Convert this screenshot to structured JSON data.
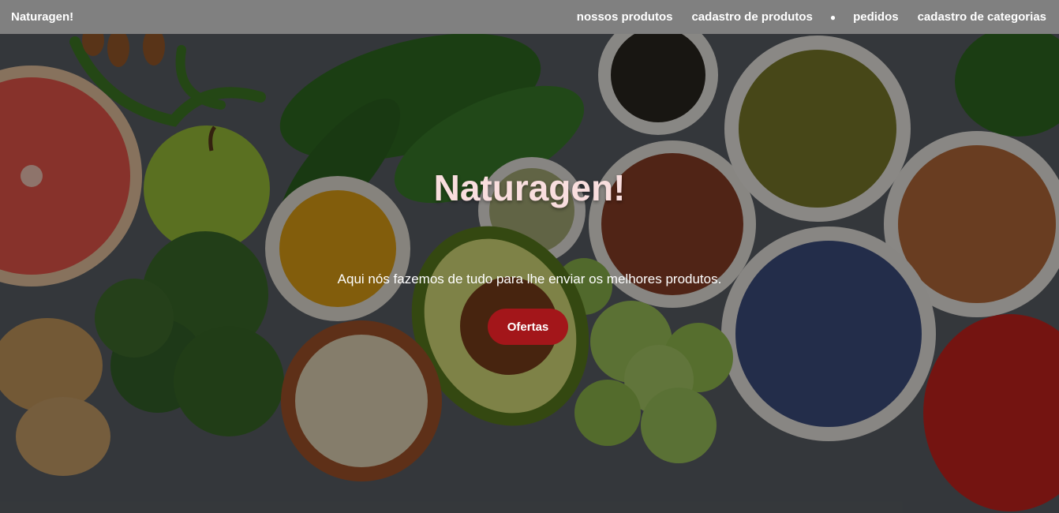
{
  "navbar": {
    "brand": "Naturagen!",
    "links": [
      "nossos produtos",
      "cadastro de produtos",
      "pedidos",
      "cadastro de categorias"
    ]
  },
  "hero": {
    "title": "Naturagen!",
    "subtitle": "Aqui nós fazemos de tudo para lhe enviar os melhores produtos.",
    "button_label": "Ofertas"
  },
  "colors": {
    "navbar_bg": "#808080",
    "button_bg": "#a3161a",
    "title_color": "#f9dede"
  }
}
